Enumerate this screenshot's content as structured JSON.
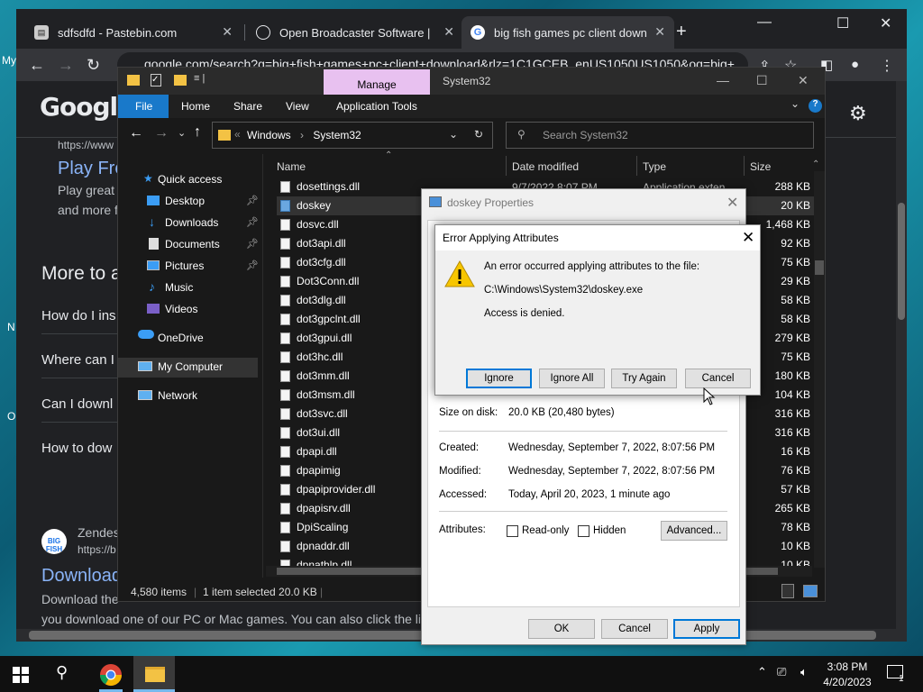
{
  "desktop": {
    "left_labels": [
      "My",
      "N",
      "O"
    ]
  },
  "chrome": {
    "tabs": [
      {
        "title": "sdfsdfd - Pastebin.com",
        "favicon": "pastebin-icon"
      },
      {
        "title": "Open Broadcaster Software | OBS",
        "favicon": "obs-icon"
      },
      {
        "title": "big fish games pc client download",
        "favicon": "google-icon"
      }
    ],
    "new_tab": "+",
    "url": "google.com/search?q=big+fish+games+pc+client+download&rlz=1C1GCEB_enUS1050US1050&oq=big+",
    "page": {
      "logo": "Google",
      "snippet_url": "https://www",
      "result_link_1": "Play Fre",
      "result_text_1a": "Play great",
      "result_text_1b": "and more f",
      "more_heading": "More to a",
      "questions": [
        "How do I ins",
        "Where can I",
        "Can I downl",
        "How to dow"
      ],
      "zendesk_title": "Zendes",
      "zendesk_url": "https://b",
      "bigfish_logo": "BIG FISH",
      "download_link": "Download",
      "desc_line1": "Download the",
      "desc_line2": "you download one of our PC or Mac games. You can also click the li"
    }
  },
  "explorer": {
    "quick_access_icons": [
      "folder-icon",
      "checkmark-icon",
      "folder-icon"
    ],
    "manage_tab": "Manage",
    "window_title": "System32",
    "ribbon_tabs": [
      "File",
      "Home",
      "Share",
      "View",
      "Application Tools"
    ],
    "address": {
      "part1": "Windows",
      "part2": "System32"
    },
    "search_placeholder": "Search System32",
    "nav": [
      {
        "label": "Quick access",
        "icon": "star-icon"
      },
      {
        "label": "Desktop",
        "icon": "desktop-icon",
        "pinned": true
      },
      {
        "label": "Downloads",
        "icon": "download-icon",
        "pinned": true
      },
      {
        "label": "Documents",
        "icon": "document-icon",
        "pinned": true
      },
      {
        "label": "Pictures",
        "icon": "pictures-icon",
        "pinned": true
      },
      {
        "label": "Music",
        "icon": "music-icon"
      },
      {
        "label": "Videos",
        "icon": "video-icon"
      },
      {
        "label": "OneDrive",
        "icon": "cloud-icon"
      },
      {
        "label": "My Computer",
        "icon": "computer-icon"
      },
      {
        "label": "Network",
        "icon": "network-icon"
      }
    ],
    "columns": {
      "name": "Name",
      "date": "Date modified",
      "type": "Type",
      "size": "Size"
    },
    "files": [
      {
        "name": "dosettings.dll",
        "size": "288 KB"
      },
      {
        "name": "doskey",
        "size": "20 KB",
        "selected": true
      },
      {
        "name": "dosvc.dll",
        "size": "1,468 KB"
      },
      {
        "name": "dot3api.dll",
        "size": "92 KB"
      },
      {
        "name": "dot3cfg.dll",
        "size": "75 KB"
      },
      {
        "name": "Dot3Conn.dll",
        "size": "29 KB"
      },
      {
        "name": "dot3dlg.dll",
        "size": "58 KB"
      },
      {
        "name": "dot3gpclnt.dll",
        "size": "58 KB"
      },
      {
        "name": "dot3gpui.dll",
        "size": "279 KB"
      },
      {
        "name": "dot3hc.dll",
        "size": "75 KB"
      },
      {
        "name": "dot3mm.dll",
        "size": "180 KB"
      },
      {
        "name": "dot3msm.dll",
        "size": "104 KB"
      },
      {
        "name": "dot3svc.dll",
        "size": "316 KB"
      },
      {
        "name": "dot3ui.dll",
        "size": "316 KB"
      },
      {
        "name": "dpapi.dll",
        "size": "16 KB"
      },
      {
        "name": "dpapimig",
        "size": "76 KB"
      },
      {
        "name": "dpapiprovider.dll",
        "size": "57 KB"
      },
      {
        "name": "dpapisrv.dll",
        "size": "265 KB"
      },
      {
        "name": "DpiScaling",
        "size": "78 KB"
      },
      {
        "name": "dpnaddr.dll",
        "size": "10 KB"
      },
      {
        "name": "dpnathlp.dll",
        "size": "10 KB"
      }
    ],
    "first_row_date": "9/7/2022 8:07 PM",
    "first_row_type": "Application exten",
    "status": {
      "items": "4,580 items",
      "selected": "1 item selected  20.0 KB"
    }
  },
  "props": {
    "title": "doskey Properties",
    "size_on_disk_label": "Size on disk:",
    "size_on_disk": "20.0 KB (20,480 bytes)",
    "created_label": "Created:",
    "created": "Wednesday, September 7, 2022, 8:07:56 PM",
    "modified_label": "Modified:",
    "modified": "Wednesday, September 7, 2022, 8:07:56 PM",
    "accessed_label": "Accessed:",
    "accessed": "Today, April 20, 2023, 1 minute ago",
    "attributes_label": "Attributes:",
    "readonly_label": "Read-only",
    "hidden_label": "Hidden",
    "advanced_btn": "Advanced...",
    "ok_btn": "OK",
    "cancel_btn": "Cancel",
    "apply_btn": "Apply"
  },
  "error": {
    "title": "Error Applying Attributes",
    "message": "An error occurred applying attributes to the file:",
    "path": "C:\\Windows\\System32\\doskey.exe",
    "detail": "Access is denied.",
    "ignore_btn": "Ignore",
    "ignore_all_btn": "Ignore All",
    "try_again_btn": "Try Again",
    "cancel_btn": "Cancel"
  },
  "taskbar": {
    "time": "3:08 PM",
    "date": "4/20/2023",
    "notification_count": "1"
  }
}
